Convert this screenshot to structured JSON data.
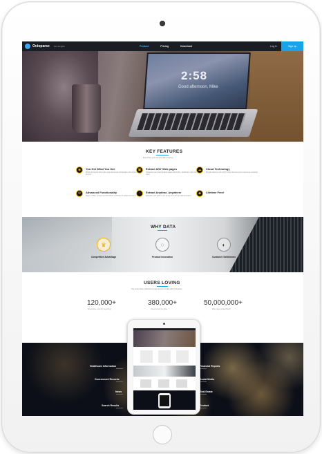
{
  "nav": {
    "brand": "Octoparse",
    "language": "Intl  |  English",
    "links": [
      "Product",
      "Pricing",
      "Download"
    ],
    "login": "Log in",
    "signup": "Sign up",
    "accent": "#1aa3e8"
  },
  "hero": {
    "clock": "2:58",
    "date": "Good afternoon, Mike"
  },
  "features": {
    "title": "KEY FEATURES",
    "subtitle": "Everything you need for web scraping",
    "items": [
      {
        "title": "You Get What You See",
        "icon": "eye-icon",
        "text": "Simply point and click on the web element and Octoparse will extract data for you."
      },
      {
        "title": "Extract ANY Web pages",
        "icon": "browser-icon",
        "text": "Octoparse can crawl dynamic pages with AJAX, JavaScript, login and more."
      },
      {
        "title": "Cloud Technology",
        "icon": "cloud-icon",
        "text": "Run the tasks on cloud 24/7 using cloud servers to speed up extraction."
      },
      {
        "title": "Advanced Functionality",
        "icon": "gear-icon",
        "text": "Regex, XPath, proxies and scheduled extraction for advanced users."
      },
      {
        "title": "Extract Anytime, Anywhere",
        "icon": "clock-icon",
        "text": "Schedule your tasks to run at any time and get data anywhere."
      },
      {
        "title": "Lifetime Free!",
        "icon": "diamond-icon",
        "text": ""
      }
    ]
  },
  "why": {
    "title": "WHY DATA",
    "items": [
      {
        "label": "Competitive Advantage",
        "icon": "trophy-icon"
      },
      {
        "label": "Product Innovation",
        "icon": "lightbulb-icon"
      },
      {
        "label": "Customer Sentiments",
        "icon": "chart-icon"
      }
    ]
  },
  "users": {
    "title": "USERS LOVING",
    "subtitle": "Our users have collected a huge amount of data with Octoparse",
    "stats": [
      {
        "value": "120,000+",
        "label": "Enterprises currently supporting"
      },
      {
        "value": "380,000+",
        "label": "Users across the globe"
      },
      {
        "value": "50,000,000+",
        "label": "Web pages scraped daily"
      }
    ]
  },
  "industries": {
    "left": [
      "Healthcare Information",
      "Government Records",
      "News",
      "Search Results"
    ],
    "right": [
      "Financial Reports",
      "Social Media",
      "Real Estate",
      "Product"
    ]
  }
}
